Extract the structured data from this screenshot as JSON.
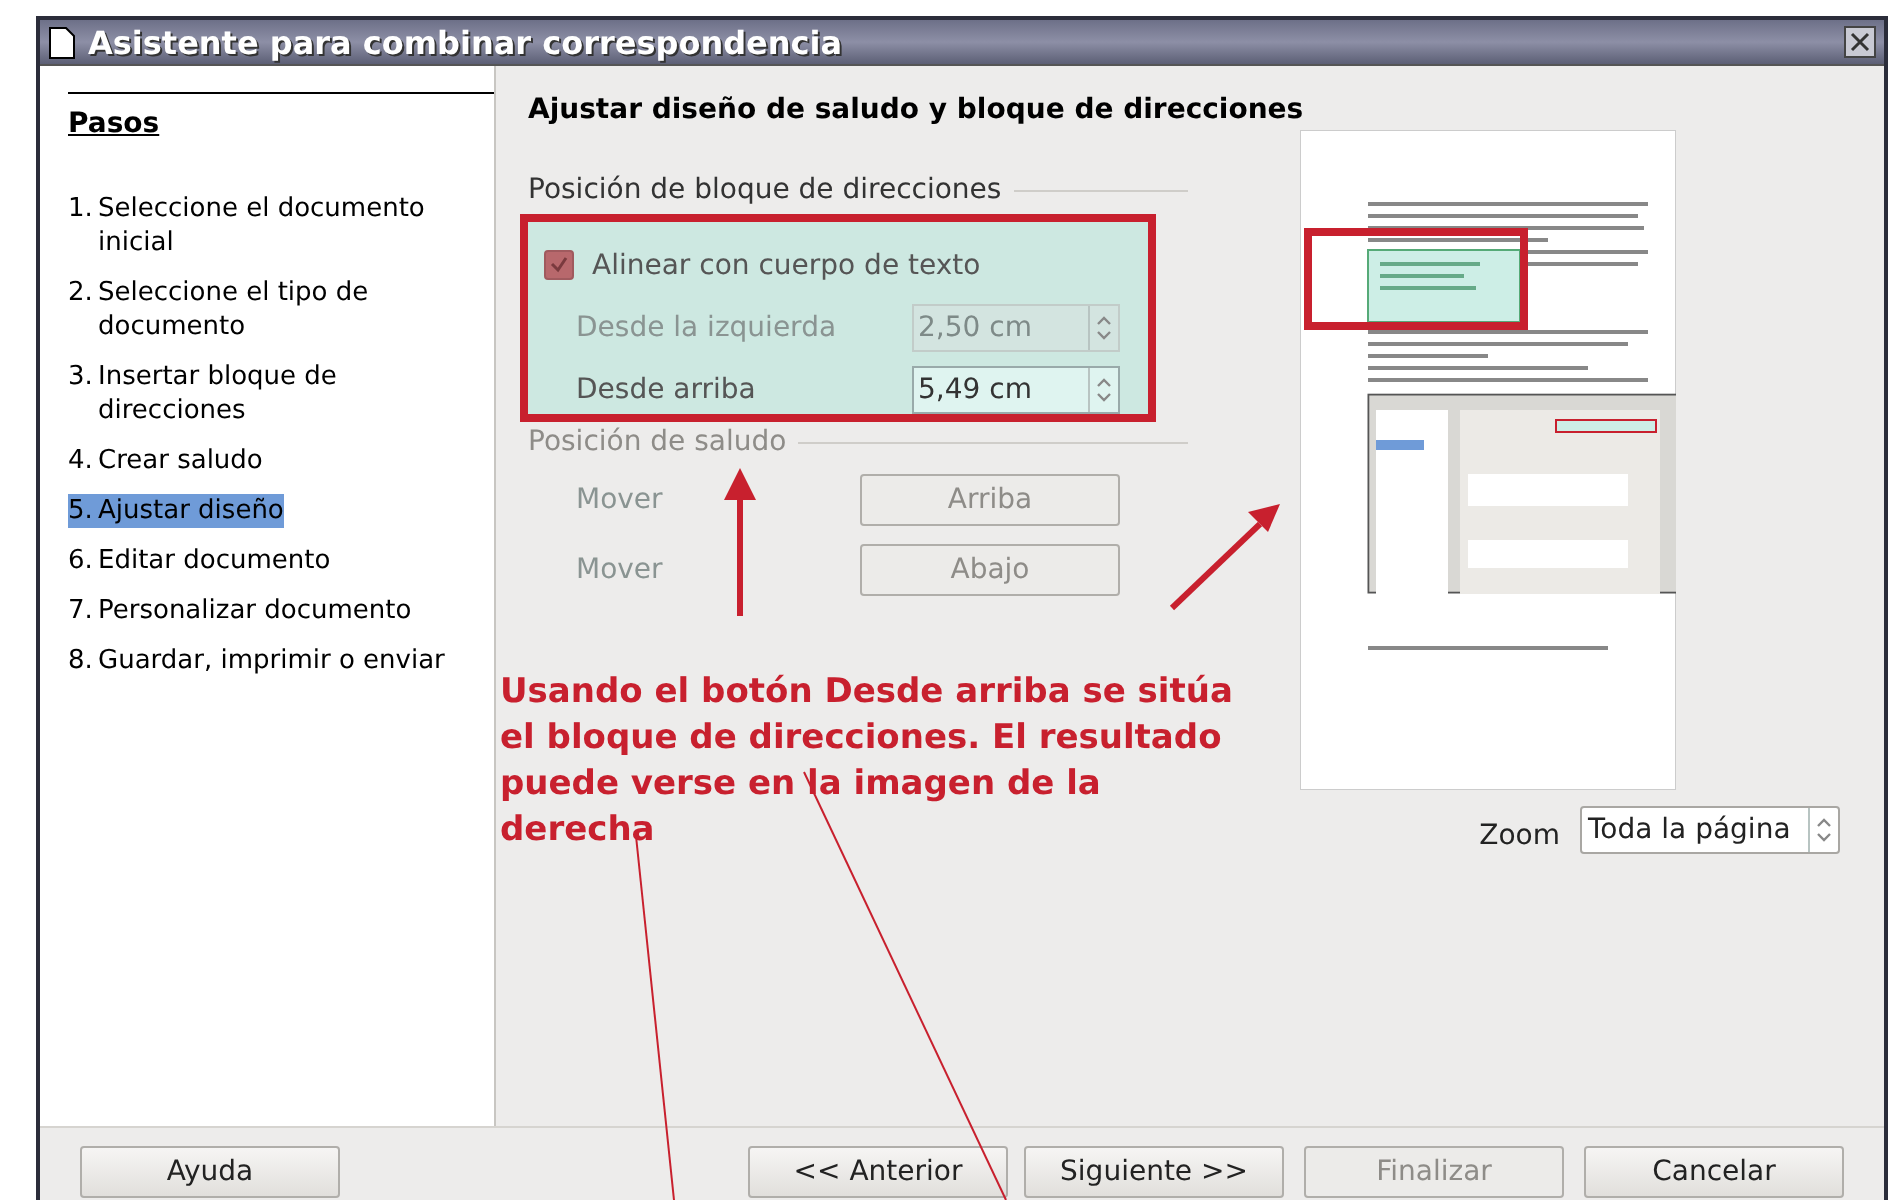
{
  "window": {
    "title": "Asistente para combinar correspondencia"
  },
  "sidebar": {
    "heading": "Pasos",
    "steps": [
      {
        "number": "1.",
        "label": "Seleccione el documento inicial",
        "selected": false
      },
      {
        "number": "2.",
        "label": "Seleccione el tipo de documento",
        "selected": false
      },
      {
        "number": "3.",
        "label": "Insertar bloque de direcciones",
        "selected": false
      },
      {
        "number": "4.",
        "label": "Crear saludo",
        "selected": false
      },
      {
        "number": "5.",
        "label": "Ajustar diseño",
        "selected": true
      },
      {
        "number": "6.",
        "label": "Editar documento",
        "selected": false
      },
      {
        "number": "7.",
        "label": "Personalizar documento",
        "selected": false
      },
      {
        "number": "8.",
        "label": "Guardar, imprimir o enviar",
        "selected": false
      }
    ]
  },
  "page_title": "Ajustar diseño de saludo y bloque de direcciones",
  "address_block": {
    "heading": "Posición de bloque de direcciones",
    "align": {
      "label": "Alinear con cuerpo de texto",
      "checked": true
    },
    "fields": [
      {
        "label": "Desde la izquierda",
        "value": "2,50 cm",
        "disabled": true
      },
      {
        "label": "Desde arriba",
        "value": "5,49 cm",
        "disabled": false
      }
    ]
  },
  "salutation": {
    "heading": "Posición de saludo",
    "moves": [
      {
        "label": "Mover",
        "button": "Arriba",
        "disabled": true
      },
      {
        "label": "Mover",
        "button": "Abajo",
        "disabled": true
      }
    ]
  },
  "annotation": {
    "lines": [
      "Usando el botón Desde arriba se sitúa",
      "el bloque de direcciones. El resultado",
      "puede verse en la imagen de la",
      "derecha"
    ]
  },
  "zoom": {
    "label": "Zoom",
    "value": "Toda la página"
  },
  "buttons": [
    {
      "label": "Ayuda",
      "disabled": false
    },
    {
      "label": "<< Anterior",
      "disabled": false
    },
    {
      "label": "Siguiente >>",
      "disabled": false
    },
    {
      "label": "Finalizar",
      "disabled": true
    },
    {
      "label": "Cancelar",
      "disabled": false
    }
  ]
}
